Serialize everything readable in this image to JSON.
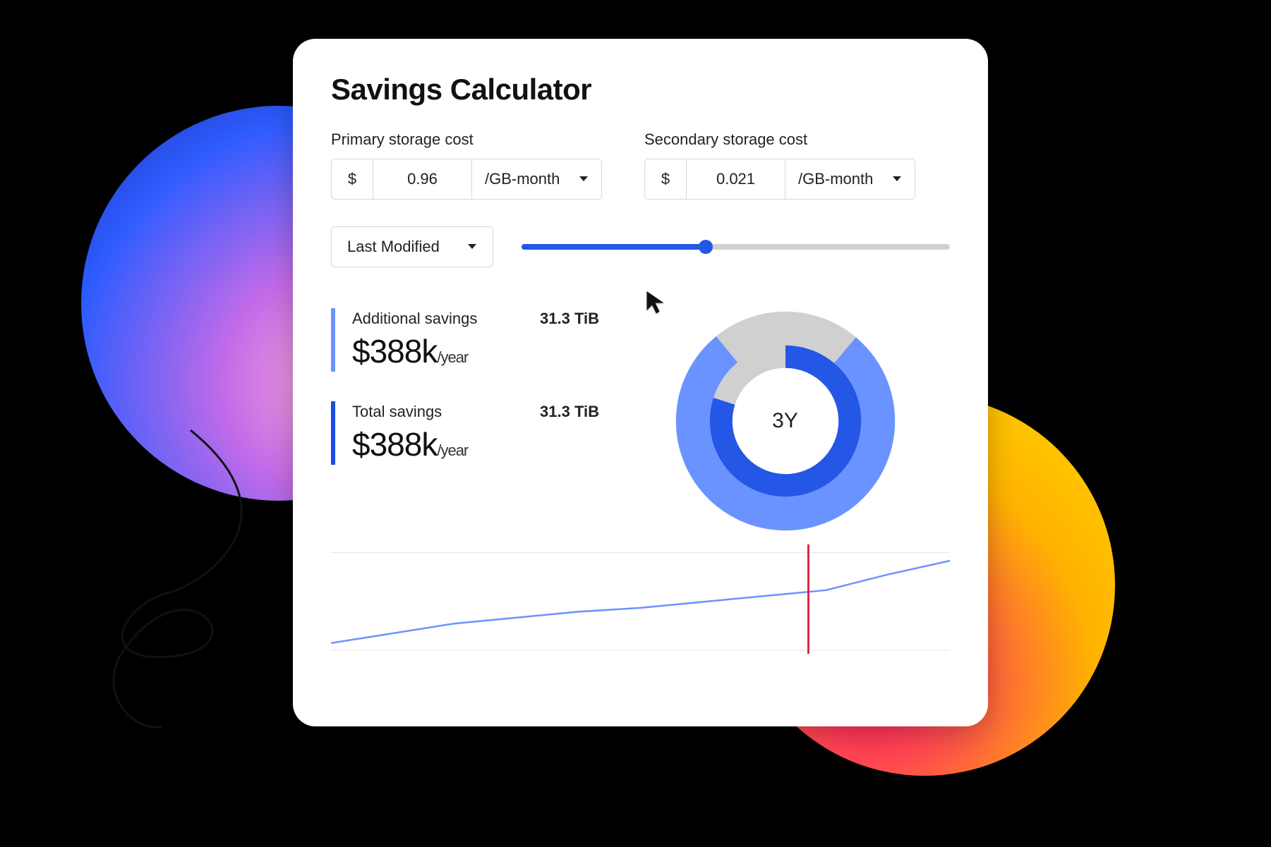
{
  "card": {
    "title": "Savings Calculator",
    "primary": {
      "label": "Primary storage cost",
      "currency": "$",
      "value": "0.96",
      "unit": "/GB-month"
    },
    "secondary": {
      "label": "Secondary storage cost",
      "currency": "$",
      "value": "0.021",
      "unit": "/GB-month"
    },
    "modified_select": "Last Modified",
    "slider": {
      "percent": 43
    },
    "additional_savings": {
      "label": "Additional savings",
      "size": "31.3 TiB",
      "amount": "$388k",
      "unit": "/year"
    },
    "total_savings": {
      "label": "Total savings",
      "size": "31.3 TiB",
      "amount": "$388k",
      "unit": "/year"
    },
    "donut": {
      "center_label": "3Y"
    },
    "line_marker_percent": 77
  },
  "chart_data": [
    {
      "type": "pie",
      "title": "",
      "series": [
        {
          "name": "inner-dark",
          "values": [
            80,
            20
          ],
          "colors": [
            "#2457e6",
            "#d0d0d0"
          ]
        },
        {
          "name": "outer-light",
          "values": [
            78,
            22
          ],
          "colors": [
            "#6b93ff",
            "#d0d0d0"
          ]
        }
      ],
      "center_label": "3Y"
    },
    {
      "type": "line",
      "x": [
        0,
        0.1,
        0.2,
        0.3,
        0.4,
        0.5,
        0.6,
        0.7,
        0.8,
        0.9,
        1.0
      ],
      "values": [
        0.08,
        0.18,
        0.28,
        0.34,
        0.4,
        0.44,
        0.5,
        0.56,
        0.62,
        0.78,
        0.92
      ],
      "ylim": [
        0,
        1
      ],
      "marker_x": 0.77
    }
  ]
}
